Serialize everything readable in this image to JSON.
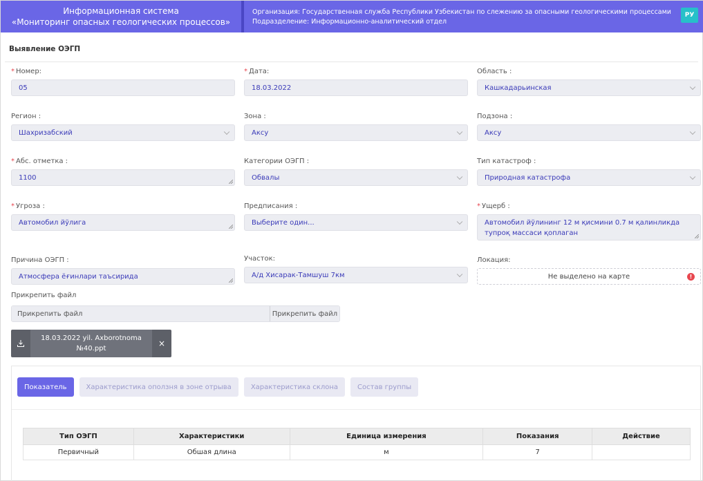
{
  "header": {
    "system_line1": "Информационная система",
    "system_line2": "«Мониторинг опасных геологических процессов»",
    "organization": "Организация: Государственная служба Республики Узбекистан по слежению за опасными геологическими процессами",
    "department": "Подразделение: Информационно-аналитический отдел",
    "language": "РУ"
  },
  "section_title": "Выявление ОЭГП",
  "fields": {
    "number": {
      "label": "Номер:",
      "value": "05",
      "required": true
    },
    "date": {
      "label": "Дата:",
      "value": "18.03.2022",
      "required": true
    },
    "region_area": {
      "label": "Область :",
      "value": "Кашкадарьинская"
    },
    "region": {
      "label": "Регион :",
      "value": "Шахризабский"
    },
    "zone": {
      "label": "Зона :",
      "value": "Аксу"
    },
    "subzone": {
      "label": "Подзона :",
      "value": "Аксу"
    },
    "abs_mark": {
      "label": "Абс. отметка :",
      "value": "1100",
      "required": true
    },
    "category": {
      "label": "Категории ОЭГП :",
      "value": "Обвалы"
    },
    "disaster_type": {
      "label": "Тип катастроф :",
      "value": "Природная катастрофа"
    },
    "threat": {
      "label": "Угроза :",
      "value": "Автомобил йўлига",
      "required": true
    },
    "prescriptions": {
      "label": "Предписания :",
      "value": "Выберите один..."
    },
    "damage": {
      "label": "Ущерб :",
      "value": "Автомобил йўлининг 12 м қисмини 0.7 м қалинликда тупроқ массаси қоплаган",
      "required": true
    },
    "cause": {
      "label": "Причина ОЭГП :",
      "value": "Атмосфера ёғинлари таъсирида"
    },
    "site": {
      "label": "Участок:",
      "value": "А/д Хисарак-Тамшуш 7км"
    },
    "location": {
      "label": "Локация:",
      "value": "Не выделено на карте"
    }
  },
  "attach": {
    "label": "Прикрепить файл",
    "placeholder": "Прикрепить файл",
    "button": "Прикрепить файл",
    "file_name": "18.03.2022 yil. Axborotnoma №40.ppt"
  },
  "tabs": [
    {
      "label": "Показатель",
      "active": true
    },
    {
      "label": "Характеристика оползня в зоне отрыва",
      "active": false
    },
    {
      "label": "Характеристика склона",
      "active": false
    },
    {
      "label": "Состав группы",
      "active": false
    }
  ],
  "table": {
    "headers": [
      "Тип ОЭГП",
      "Характеристики",
      "Единица измерения",
      "Показания",
      "Действие"
    ],
    "rows": [
      [
        "Первичный",
        "Обшая длина",
        "м",
        "7",
        ""
      ]
    ]
  },
  "colors": {
    "accent": "#6a66e6",
    "required": "#e8474f",
    "lang": "#27c0c9"
  }
}
